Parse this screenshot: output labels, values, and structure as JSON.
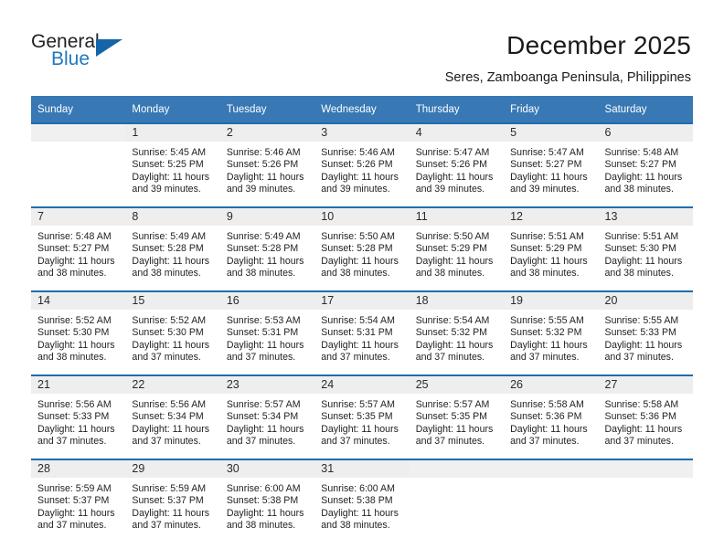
{
  "brand": {
    "name_top": "General",
    "name_bottom": "Blue",
    "triangle_icon": "triangle-icon",
    "accent_color": "#1f78c1",
    "triangle_color": "#1565a8"
  },
  "header": {
    "title": "December 2025",
    "subtitle": "Seres, Zamboanga Peninsula, Philippines"
  },
  "calendar": {
    "header_bg": "#3878b4",
    "row_border_color": "#1f6cad",
    "daynum_bg": "#eeeeee",
    "weekday_headers": [
      "Sunday",
      "Monday",
      "Tuesday",
      "Wednesday",
      "Thursday",
      "Friday",
      "Saturday"
    ],
    "labels": {
      "sunrise": "Sunrise:",
      "sunset": "Sunset:",
      "daylight": "Daylight:"
    },
    "weeks": [
      [
        {
          "day": "",
          "sunrise": "",
          "sunset": "",
          "daylight_line1": "",
          "daylight_line2": ""
        },
        {
          "day": "1",
          "sunrise": "Sunrise: 5:45 AM",
          "sunset": "Sunset: 5:25 PM",
          "daylight_line1": "Daylight: 11 hours",
          "daylight_line2": "and 39 minutes."
        },
        {
          "day": "2",
          "sunrise": "Sunrise: 5:46 AM",
          "sunset": "Sunset: 5:26 PM",
          "daylight_line1": "Daylight: 11 hours",
          "daylight_line2": "and 39 minutes."
        },
        {
          "day": "3",
          "sunrise": "Sunrise: 5:46 AM",
          "sunset": "Sunset: 5:26 PM",
          "daylight_line1": "Daylight: 11 hours",
          "daylight_line2": "and 39 minutes."
        },
        {
          "day": "4",
          "sunrise": "Sunrise: 5:47 AM",
          "sunset": "Sunset: 5:26 PM",
          "daylight_line1": "Daylight: 11 hours",
          "daylight_line2": "and 39 minutes."
        },
        {
          "day": "5",
          "sunrise": "Sunrise: 5:47 AM",
          "sunset": "Sunset: 5:27 PM",
          "daylight_line1": "Daylight: 11 hours",
          "daylight_line2": "and 39 minutes."
        },
        {
          "day": "6",
          "sunrise": "Sunrise: 5:48 AM",
          "sunset": "Sunset: 5:27 PM",
          "daylight_line1": "Daylight: 11 hours",
          "daylight_line2": "and 38 minutes."
        }
      ],
      [
        {
          "day": "7",
          "sunrise": "Sunrise: 5:48 AM",
          "sunset": "Sunset: 5:27 PM",
          "daylight_line1": "Daylight: 11 hours",
          "daylight_line2": "and 38 minutes."
        },
        {
          "day": "8",
          "sunrise": "Sunrise: 5:49 AM",
          "sunset": "Sunset: 5:28 PM",
          "daylight_line1": "Daylight: 11 hours",
          "daylight_line2": "and 38 minutes."
        },
        {
          "day": "9",
          "sunrise": "Sunrise: 5:49 AM",
          "sunset": "Sunset: 5:28 PM",
          "daylight_line1": "Daylight: 11 hours",
          "daylight_line2": "and 38 minutes."
        },
        {
          "day": "10",
          "sunrise": "Sunrise: 5:50 AM",
          "sunset": "Sunset: 5:28 PM",
          "daylight_line1": "Daylight: 11 hours",
          "daylight_line2": "and 38 minutes."
        },
        {
          "day": "11",
          "sunrise": "Sunrise: 5:50 AM",
          "sunset": "Sunset: 5:29 PM",
          "daylight_line1": "Daylight: 11 hours",
          "daylight_line2": "and 38 minutes."
        },
        {
          "day": "12",
          "sunrise": "Sunrise: 5:51 AM",
          "sunset": "Sunset: 5:29 PM",
          "daylight_line1": "Daylight: 11 hours",
          "daylight_line2": "and 38 minutes."
        },
        {
          "day": "13",
          "sunrise": "Sunrise: 5:51 AM",
          "sunset": "Sunset: 5:30 PM",
          "daylight_line1": "Daylight: 11 hours",
          "daylight_line2": "and 38 minutes."
        }
      ],
      [
        {
          "day": "14",
          "sunrise": "Sunrise: 5:52 AM",
          "sunset": "Sunset: 5:30 PM",
          "daylight_line1": "Daylight: 11 hours",
          "daylight_line2": "and 38 minutes."
        },
        {
          "day": "15",
          "sunrise": "Sunrise: 5:52 AM",
          "sunset": "Sunset: 5:30 PM",
          "daylight_line1": "Daylight: 11 hours",
          "daylight_line2": "and 37 minutes."
        },
        {
          "day": "16",
          "sunrise": "Sunrise: 5:53 AM",
          "sunset": "Sunset: 5:31 PM",
          "daylight_line1": "Daylight: 11 hours",
          "daylight_line2": "and 37 minutes."
        },
        {
          "day": "17",
          "sunrise": "Sunrise: 5:54 AM",
          "sunset": "Sunset: 5:31 PM",
          "daylight_line1": "Daylight: 11 hours",
          "daylight_line2": "and 37 minutes."
        },
        {
          "day": "18",
          "sunrise": "Sunrise: 5:54 AM",
          "sunset": "Sunset: 5:32 PM",
          "daylight_line1": "Daylight: 11 hours",
          "daylight_line2": "and 37 minutes."
        },
        {
          "day": "19",
          "sunrise": "Sunrise: 5:55 AM",
          "sunset": "Sunset: 5:32 PM",
          "daylight_line1": "Daylight: 11 hours",
          "daylight_line2": "and 37 minutes."
        },
        {
          "day": "20",
          "sunrise": "Sunrise: 5:55 AM",
          "sunset": "Sunset: 5:33 PM",
          "daylight_line1": "Daylight: 11 hours",
          "daylight_line2": "and 37 minutes."
        }
      ],
      [
        {
          "day": "21",
          "sunrise": "Sunrise: 5:56 AM",
          "sunset": "Sunset: 5:33 PM",
          "daylight_line1": "Daylight: 11 hours",
          "daylight_line2": "and 37 minutes."
        },
        {
          "day": "22",
          "sunrise": "Sunrise: 5:56 AM",
          "sunset": "Sunset: 5:34 PM",
          "daylight_line1": "Daylight: 11 hours",
          "daylight_line2": "and 37 minutes."
        },
        {
          "day": "23",
          "sunrise": "Sunrise: 5:57 AM",
          "sunset": "Sunset: 5:34 PM",
          "daylight_line1": "Daylight: 11 hours",
          "daylight_line2": "and 37 minutes."
        },
        {
          "day": "24",
          "sunrise": "Sunrise: 5:57 AM",
          "sunset": "Sunset: 5:35 PM",
          "daylight_line1": "Daylight: 11 hours",
          "daylight_line2": "and 37 minutes."
        },
        {
          "day": "25",
          "sunrise": "Sunrise: 5:57 AM",
          "sunset": "Sunset: 5:35 PM",
          "daylight_line1": "Daylight: 11 hours",
          "daylight_line2": "and 37 minutes."
        },
        {
          "day": "26",
          "sunrise": "Sunrise: 5:58 AM",
          "sunset": "Sunset: 5:36 PM",
          "daylight_line1": "Daylight: 11 hours",
          "daylight_line2": "and 37 minutes."
        },
        {
          "day": "27",
          "sunrise": "Sunrise: 5:58 AM",
          "sunset": "Sunset: 5:36 PM",
          "daylight_line1": "Daylight: 11 hours",
          "daylight_line2": "and 37 minutes."
        }
      ],
      [
        {
          "day": "28",
          "sunrise": "Sunrise: 5:59 AM",
          "sunset": "Sunset: 5:37 PM",
          "daylight_line1": "Daylight: 11 hours",
          "daylight_line2": "and 37 minutes."
        },
        {
          "day": "29",
          "sunrise": "Sunrise: 5:59 AM",
          "sunset": "Sunset: 5:37 PM",
          "daylight_line1": "Daylight: 11 hours",
          "daylight_line2": "and 37 minutes."
        },
        {
          "day": "30",
          "sunrise": "Sunrise: 6:00 AM",
          "sunset": "Sunset: 5:38 PM",
          "daylight_line1": "Daylight: 11 hours",
          "daylight_line2": "and 38 minutes."
        },
        {
          "day": "31",
          "sunrise": "Sunrise: 6:00 AM",
          "sunset": "Sunset: 5:38 PM",
          "daylight_line1": "Daylight: 11 hours",
          "daylight_line2": "and 38 minutes."
        },
        {
          "day": "",
          "sunrise": "",
          "sunset": "",
          "daylight_line1": "",
          "daylight_line2": ""
        },
        {
          "day": "",
          "sunrise": "",
          "sunset": "",
          "daylight_line1": "",
          "daylight_line2": ""
        },
        {
          "day": "",
          "sunrise": "",
          "sunset": "",
          "daylight_line1": "",
          "daylight_line2": ""
        }
      ]
    ]
  }
}
